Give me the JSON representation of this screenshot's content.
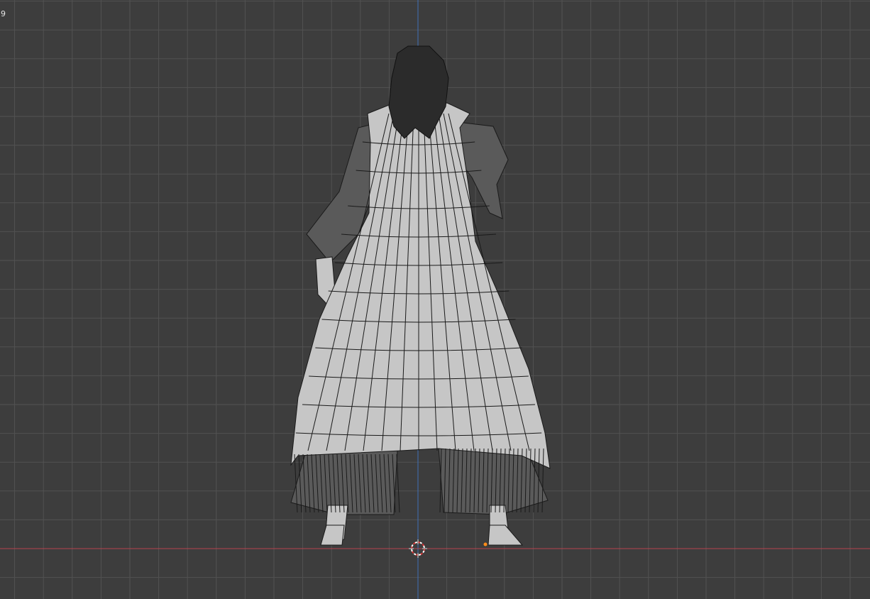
{
  "viewport": {
    "corner_label": "9",
    "background_color": "#3d3d3d",
    "grid_color": "#525252",
    "x_axis_color": "#b8434f",
    "z_axis_color": "#3e6fb8",
    "origin_color": "#d83535",
    "mesh_color": "#c6c6c6",
    "wire_color": "#1a1a1a",
    "hair_color": "#2b2b2b"
  },
  "object": {
    "icon": "character-mesh-icon",
    "origin_marker_color": "#ff8c1a"
  },
  "cursor": {
    "icon": "3d-cursor-icon"
  }
}
